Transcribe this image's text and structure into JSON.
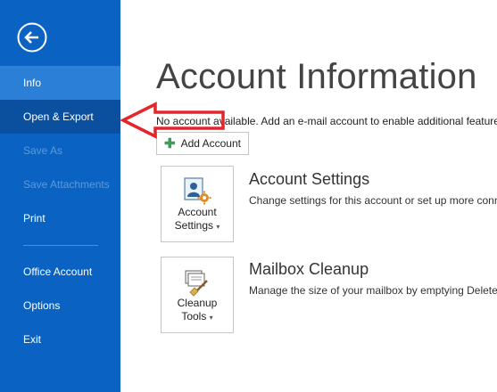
{
  "sidebar": {
    "back_label": "Back",
    "items": [
      {
        "label": "Info",
        "state": "selected"
      },
      {
        "label": "Open & Export",
        "state": "hover"
      },
      {
        "label": "Save As",
        "state": "disabled"
      },
      {
        "label": "Save Attachments",
        "state": "disabled"
      },
      {
        "label": "Print",
        "state": "normal"
      },
      {
        "label": "Office Account",
        "state": "normal"
      },
      {
        "label": "Options",
        "state": "normal"
      },
      {
        "label": "Exit",
        "state": "normal"
      }
    ]
  },
  "main": {
    "title": "Account Information",
    "info_text": "No account available. Add an e-mail account to enable additional features.",
    "add_account_label": "Add Account",
    "sections": [
      {
        "tile_label_line1": "Account",
        "tile_label_line2": "Settings",
        "title": "Account Settings",
        "description": "Change settings for this account or set up more connections."
      },
      {
        "tile_label_line1": "Cleanup",
        "tile_label_line2": "Tools",
        "title": "Mailbox Cleanup",
        "description": "Manage the size of your mailbox by emptying Deleted Items and archiving."
      }
    ]
  },
  "colors": {
    "sidebar_bg": "#0a63c2",
    "selected_bg": "#2b7fd6",
    "hover_bg": "#0b4f9f",
    "arrow": "#e3262b"
  },
  "icons": {
    "back": "back-arrow-icon",
    "add": "plus-icon",
    "account_settings": "account-settings-icon",
    "cleanup": "cleanup-tools-icon"
  }
}
